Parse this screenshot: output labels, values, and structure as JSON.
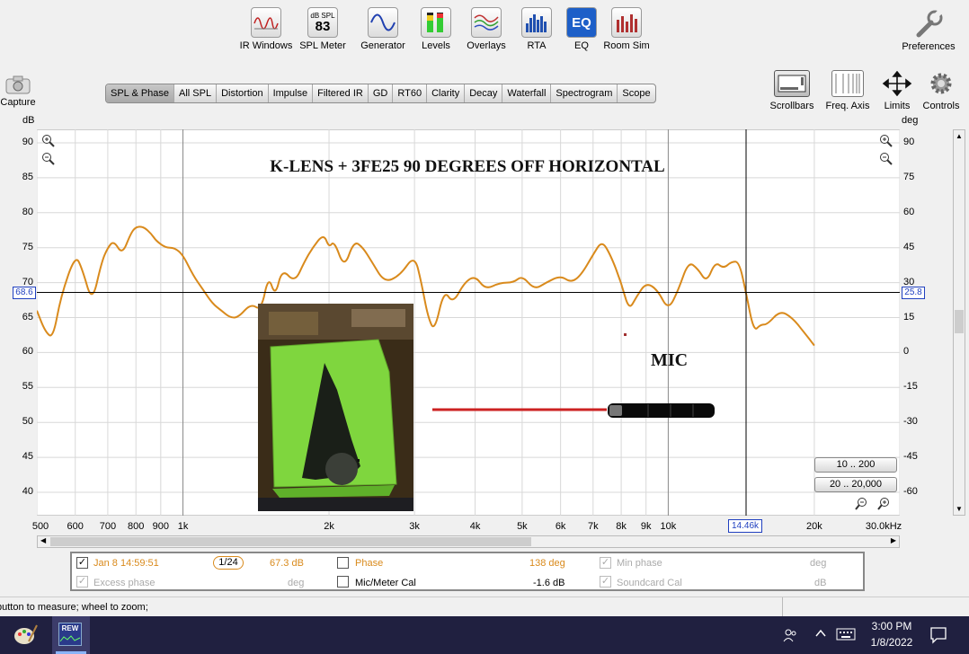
{
  "toolbar": [
    {
      "label": "IR Windows",
      "icon": "ir-windows-icon"
    },
    {
      "label": "SPL Meter",
      "icon": "spl-meter-icon",
      "badge_top": "dB SPL",
      "badge_value": "83"
    },
    {
      "label": "Generator",
      "icon": "generator-icon"
    },
    {
      "label": "Levels",
      "icon": "levels-icon"
    },
    {
      "label": "Overlays",
      "icon": "overlays-icon"
    },
    {
      "label": "RTA",
      "icon": "rta-icon"
    },
    {
      "label": "EQ",
      "icon": "eq-icon",
      "badge_value": "EQ"
    },
    {
      "label": "Room Sim",
      "icon": "room-sim-icon"
    }
  ],
  "preferences_label": "Preferences",
  "capture_label": "Capture",
  "tabs": [
    "SPL & Phase",
    "All SPL",
    "Distortion",
    "Impulse",
    "Filtered IR",
    "GD",
    "RT60",
    "Clarity",
    "Decay",
    "Waterfall",
    "Spectrogram",
    "Scope"
  ],
  "active_tab": 0,
  "right_buttons": [
    "Scrollbars",
    "Freq. Axis",
    "Limits",
    "Controls"
  ],
  "axis": {
    "left_unit": "dB",
    "right_unit": "deg",
    "left_ticks": [
      "90",
      "85",
      "80",
      "75",
      "70",
      "65",
      "60",
      "55",
      "50",
      "45",
      "40"
    ],
    "right_ticks": [
      "90",
      "75",
      "60",
      "45",
      "30",
      "15",
      "0",
      "-15",
      "-30",
      "-45",
      "-60"
    ],
    "x_ticks": [
      "500",
      "600",
      "700",
      "800",
      "900",
      "1k",
      "2k",
      "3k",
      "4k",
      "5k",
      "6k",
      "7k",
      "8k",
      "9k",
      "10k",
      "20k",
      "30.0kHz"
    ],
    "cursor_x": "14.46k",
    "cursor_left": "68.6",
    "cursor_right": "25.8"
  },
  "chart_data": {
    "type": "line",
    "title": "K-LENS + 3FE25    90 DEGREES OFF HORIZONTAL",
    "annotation": "MIC",
    "xlabel": "Hz",
    "ylabel": "dB",
    "xscale": "log",
    "xlim": [
      500,
      30000
    ],
    "ylim": [
      38,
      91
    ],
    "grid": true,
    "series": [
      {
        "color": "#d98a1c",
        "x": [
          500,
          520,
          540,
          560,
          600,
          620,
          650,
          680,
          700,
          720,
          750,
          780,
          800,
          830,
          860,
          880,
          920,
          960,
          1000,
          1050,
          1100,
          1150,
          1200,
          1250,
          1300,
          1380,
          1450,
          1500,
          1550,
          1600,
          1700,
          1780,
          1850,
          1950,
          2000,
          2050,
          2150,
          2250,
          2350,
          2450,
          2600,
          2800,
          3000,
          3100,
          3200,
          3300,
          3450,
          3600,
          3800,
          4000,
          4200,
          4500,
          4800,
          5000,
          5300,
          5600,
          6000,
          6300,
          6600,
          7000,
          7300,
          7600,
          8000,
          8300,
          8600,
          9000,
          9500,
          10000,
          10500,
          11000,
          11500,
          12000,
          12500,
          13000,
          13500,
          14000,
          14460,
          15000,
          15500,
          16000,
          17000,
          18000,
          19000,
          20000
        ],
        "y": [
          66,
          63,
          62,
          68,
          74,
          72,
          67,
          73,
          75,
          76,
          74,
          77,
          78,
          78,
          77,
          76,
          75,
          75,
          74,
          71,
          69,
          67,
          66,
          65,
          65,
          67,
          66,
          71,
          68,
          72,
          70,
          73,
          75,
          77,
          75,
          76,
          72,
          76,
          75,
          73,
          70,
          71,
          74,
          70,
          65,
          63,
          69,
          67,
          70,
          71,
          69,
          70,
          70,
          71,
          69,
          70,
          71,
          70,
          71,
          74,
          76,
          74,
          70,
          66,
          68,
          70,
          69,
          66,
          69,
          73,
          72,
          70,
          73,
          72,
          73,
          73,
          68.6,
          63,
          64,
          64,
          66,
          65,
          63,
          61
        ]
      }
    ]
  },
  "overlay": {
    "speaker_photo": "green-speaker-photo",
    "mic_shape": "microphone-shape",
    "cable_color": "#cc2222",
    "curve_color": "#d98a1c"
  },
  "range_buttons": [
    "10 .. 200",
    "20 .. 20,000"
  ],
  "legend": {
    "row1": {
      "name": "Jan 8 14:59:51",
      "smoothing": "1/24",
      "spl": "67.3 dB",
      "phase_label": "Phase",
      "phase_value": "138 deg",
      "minphase_label": "Min phase",
      "minphase_unit": "deg"
    },
    "row2": {
      "excess_label": "Excess phase",
      "excess_unit": "deg",
      "micmeter_label": "Mic/Meter Cal",
      "micmeter_value": "-1.6 dB",
      "soundcard_label": "Soundcard Cal",
      "soundcard_unit": "dB"
    }
  },
  "status_text": "button to measure; wheel to zoom;",
  "taskbar": {
    "time": "3:00 PM",
    "date": "1/8/2022",
    "rew_label": "REW"
  }
}
